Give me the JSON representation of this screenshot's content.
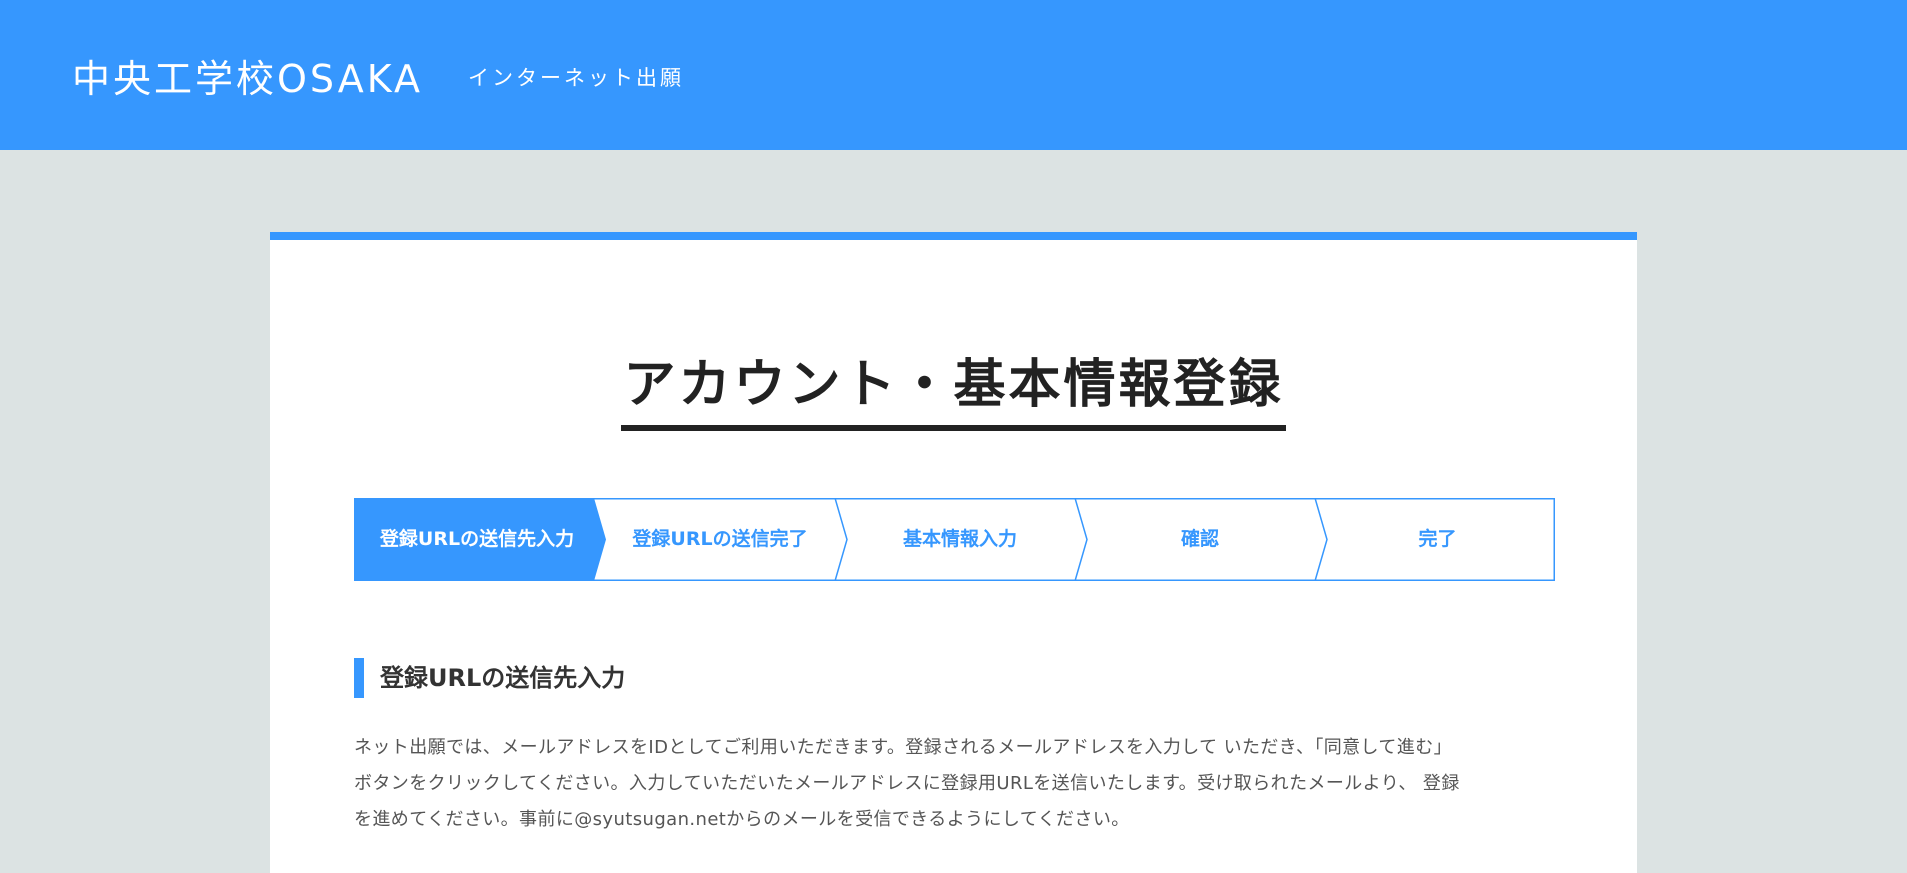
{
  "header": {
    "site_title": "中央工学校OSAKA",
    "site_subtitle": "インターネット出願"
  },
  "page": {
    "title": "アカウント・基本情報登録"
  },
  "steps": [
    {
      "label": "登録URLの送信先入力",
      "active": true
    },
    {
      "label": "登録URLの送信完了",
      "active": false
    },
    {
      "label": "基本情報入力",
      "active": false
    },
    {
      "label": "確認",
      "active": false
    },
    {
      "label": "完了",
      "active": false
    }
  ],
  "section": {
    "heading": "登録URLの送信先入力",
    "lines": [
      "ネット出願では、メールアドレスをIDとしてご利用いただきます。登録されるメールアドレスを入力して いただき、「同意して進む」",
      "ボタンをクリックしてください。入力していただいたメールアドレスに登録用URLを送信いたします。受け取られたメールより、 登録",
      "を進めてください。事前に@syutsugan.netからのメールを受信できるようにしてください。"
    ]
  },
  "colors": {
    "brand_blue": "#3697fe",
    "background": "#dce3e3",
    "card": "#ffffff",
    "title_text": "#222222"
  }
}
